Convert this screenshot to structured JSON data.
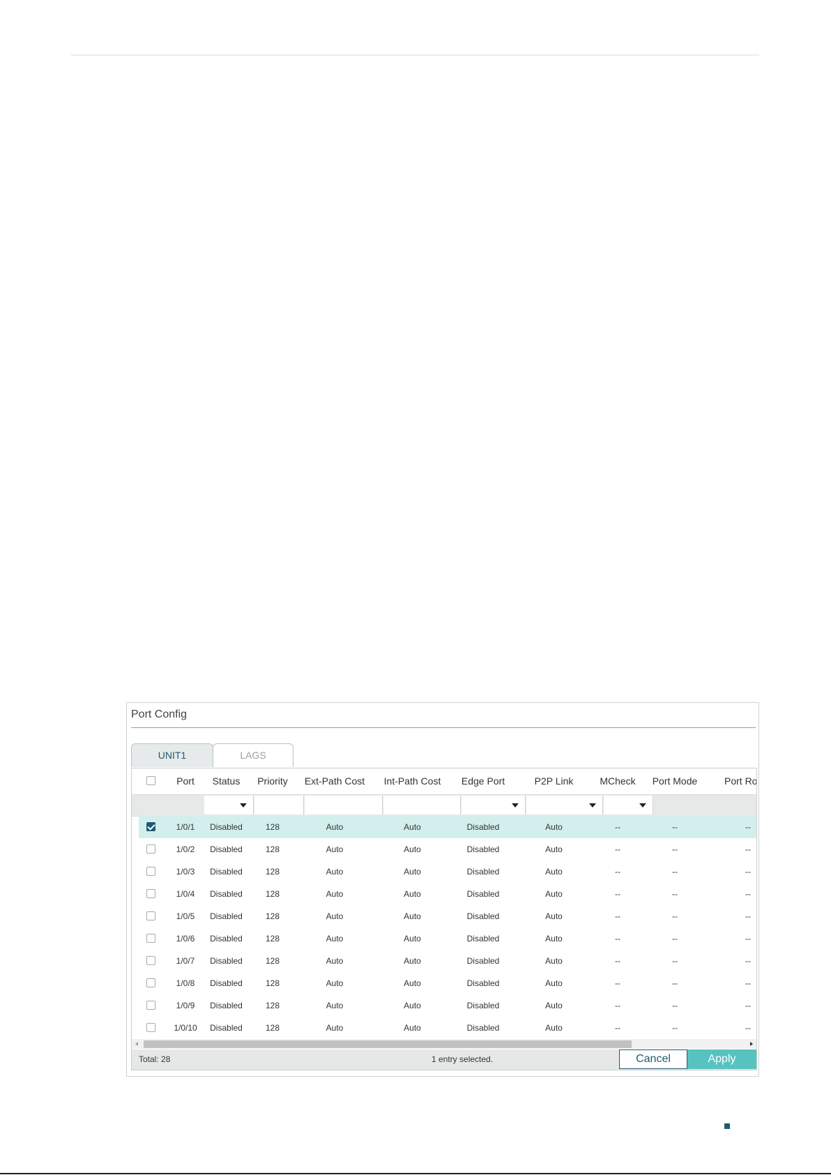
{
  "panel": {
    "title": "Port Config"
  },
  "tabs": [
    {
      "label": "UNIT1",
      "active": true
    },
    {
      "label": "LAGS",
      "active": false
    }
  ],
  "columns": [
    "Port",
    "Status",
    "Priority",
    "Ext-Path Cost",
    "Int-Path Cost",
    "Edge Port",
    "P2P Link",
    "MCheck",
    "Port Mode",
    "Port Role"
  ],
  "rows": [
    {
      "port": "1/0/1",
      "status": "Disabled",
      "priority": "128",
      "ext": "Auto",
      "int": "Auto",
      "edge": "Disabled",
      "p2p": "Auto",
      "mcheck": "--",
      "mode": "--",
      "role": "--",
      "checked": true
    },
    {
      "port": "1/0/2",
      "status": "Disabled",
      "priority": "128",
      "ext": "Auto",
      "int": "Auto",
      "edge": "Disabled",
      "p2p": "Auto",
      "mcheck": "--",
      "mode": "--",
      "role": "--",
      "checked": false
    },
    {
      "port": "1/0/3",
      "status": "Disabled",
      "priority": "128",
      "ext": "Auto",
      "int": "Auto",
      "edge": "Disabled",
      "p2p": "Auto",
      "mcheck": "--",
      "mode": "--",
      "role": "--",
      "checked": false
    },
    {
      "port": "1/0/4",
      "status": "Disabled",
      "priority": "128",
      "ext": "Auto",
      "int": "Auto",
      "edge": "Disabled",
      "p2p": "Auto",
      "mcheck": "--",
      "mode": "--",
      "role": "--",
      "checked": false
    },
    {
      "port": "1/0/5",
      "status": "Disabled",
      "priority": "128",
      "ext": "Auto",
      "int": "Auto",
      "edge": "Disabled",
      "p2p": "Auto",
      "mcheck": "--",
      "mode": "--",
      "role": "--",
      "checked": false
    },
    {
      "port": "1/0/6",
      "status": "Disabled",
      "priority": "128",
      "ext": "Auto",
      "int": "Auto",
      "edge": "Disabled",
      "p2p": "Auto",
      "mcheck": "--",
      "mode": "--",
      "role": "--",
      "checked": false
    },
    {
      "port": "1/0/7",
      "status": "Disabled",
      "priority": "128",
      "ext": "Auto",
      "int": "Auto",
      "edge": "Disabled",
      "p2p": "Auto",
      "mcheck": "--",
      "mode": "--",
      "role": "--",
      "checked": false
    },
    {
      "port": "1/0/8",
      "status": "Disabled",
      "priority": "128",
      "ext": "Auto",
      "int": "Auto",
      "edge": "Disabled",
      "p2p": "Auto",
      "mcheck": "--",
      "mode": "--",
      "role": "--",
      "checked": false
    },
    {
      "port": "1/0/9",
      "status": "Disabled",
      "priority": "128",
      "ext": "Auto",
      "int": "Auto",
      "edge": "Disabled",
      "p2p": "Auto",
      "mcheck": "--",
      "mode": "--",
      "role": "--",
      "checked": false
    },
    {
      "port": "1/0/10",
      "status": "Disabled",
      "priority": "128",
      "ext": "Auto",
      "int": "Auto",
      "edge": "Disabled",
      "p2p": "Auto",
      "mcheck": "--",
      "mode": "--",
      "role": "--",
      "checked": false
    }
  ],
  "footer": {
    "total": "Total: 28",
    "selected": "1 entry selected.",
    "cancel_label": "Cancel",
    "apply_label": "Apply"
  },
  "colors": {
    "accent": "#1f5a72",
    "apply_button": "#56c3c1",
    "selected_row": "#d3efed"
  }
}
